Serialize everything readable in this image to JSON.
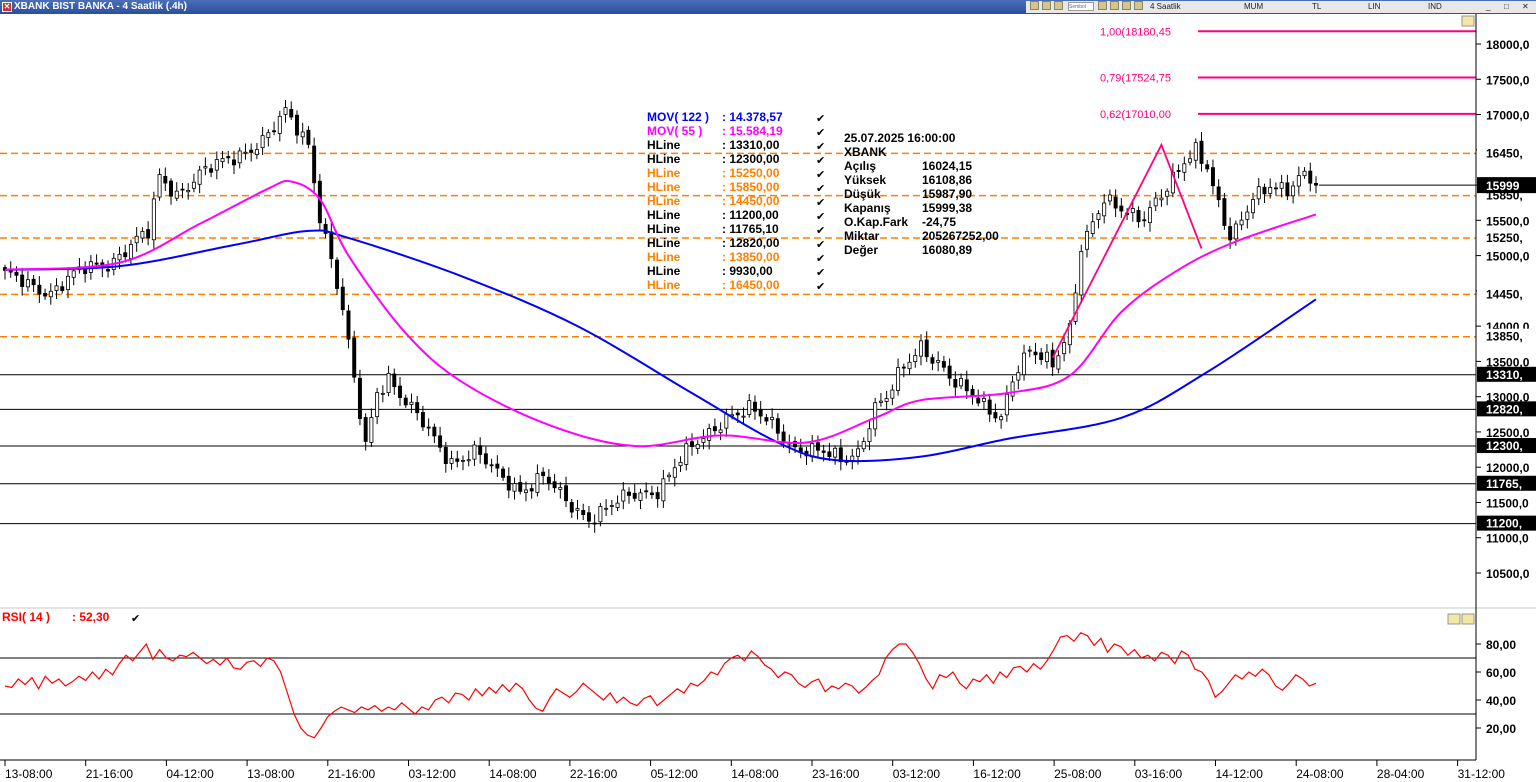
{
  "window": {
    "title": "XBANK BIST BANKA - 4 Saatlik (.4h)",
    "toolbar": {
      "period": "4 Saatlik",
      "chart_type": "MUM",
      "currency": "TL",
      "scale": "LIN",
      "indicator": "IND",
      "search_placeholder": "Sembol"
    }
  },
  "colors": {
    "mov122": "#0000ff",
    "mov55": "#ff00ff",
    "hline_black": "#000000",
    "hline_orange": "#ff8000",
    "fib": "#ff0080",
    "rsi": "#ff0000"
  },
  "legend": [
    {
      "name": "MOV( 122 )",
      "value": ": 14.378,57",
      "color": "#0000ff"
    },
    {
      "name": "MOV( 55 )",
      "value": ": 15.584,19",
      "color": "#ff00ff"
    },
    {
      "name": "HLine",
      "value": ": 13310,00",
      "color": "#000000"
    },
    {
      "name": "HLine",
      "value": ": 12300,00",
      "color": "#000000"
    },
    {
      "name": "HLine",
      "value": ": 15250,00",
      "color": "#ff8000"
    },
    {
      "name": "HLine",
      "value": ": 15850,00",
      "color": "#ff8000"
    },
    {
      "name": "HLine",
      "value": ": 14450,00",
      "color": "#ff8000"
    },
    {
      "name": "HLine",
      "value": ": 11200,00",
      "color": "#000000"
    },
    {
      "name": "HLine",
      "value": ": 11765,10",
      "color": "#000000"
    },
    {
      "name": "HLine",
      "value": ": 12820,00",
      "color": "#000000"
    },
    {
      "name": "HLine",
      "value": ": 13850,00",
      "color": "#ff8000"
    },
    {
      "name": "HLine",
      "value": ": 9930,00",
      "color": "#000000"
    },
    {
      "name": "HLine",
      "value": ": 16450,00",
      "color": "#ff8000"
    }
  ],
  "info_box": {
    "datetime": "25.07.2025  16:00:00",
    "symbol": "XBANK",
    "rows": [
      {
        "label": "Açılış",
        "value": "16024,15"
      },
      {
        "label": "Yüksek",
        "value": "16108,86"
      },
      {
        "label": "Düşük",
        "value": "15987,90"
      },
      {
        "label": "Kapanış",
        "value": "15999,38"
      },
      {
        "label": "O.Kap.Fark",
        "value": "-24,75"
      },
      {
        "label": "Miktar",
        "value": "205267252,00"
      },
      {
        "label": "Değer",
        "value": "16080,89"
      }
    ]
  },
  "fib_labels": [
    {
      "text": "1,00(18180,45",
      "level": 18180.45
    },
    {
      "text": "0,79(17524,75",
      "level": 17524.75
    },
    {
      "text": "0,62(17010,00",
      "level": 17010.0
    }
  ],
  "rsi_legend": {
    "name": "RSI( 14 )",
    "value": ": 52,30"
  },
  "chart_data": [
    {
      "type": "candlestick",
      "symbol": "XBANK",
      "timeframe": "4h",
      "y_axis": {
        "ticks": [
          "18000,0",
          "17500,0",
          "17000,0",
          "16500,0",
          "16000,0",
          "15500,0",
          "15000,0",
          "14500,0",
          "14000,0",
          "13500,0",
          "13000,0",
          "12500,0",
          "12000,0",
          "11500,0",
          "11000,0",
          "10500,0"
        ],
        "ylim": [
          10000,
          18400
        ],
        "last_price_label": "15999"
      },
      "x_ticks": [
        "13-08:00",
        "21-16:00",
        "04-12:00",
        "13-08:00",
        "21-16:00",
        "03-12:00",
        "14-08:00",
        "22-16:00",
        "05-12:00",
        "14-08:00",
        "23-16:00",
        "03-12:00",
        "16-12:00",
        "25-08:00",
        "03-16:00",
        "14-12:00",
        "24-08:00",
        "28-04:00",
        "31-12:00"
      ],
      "price_path": [
        [
          0,
          14700
        ],
        [
          8,
          14500
        ],
        [
          14,
          14800
        ],
        [
          18,
          14900
        ],
        [
          22,
          15150
        ],
        [
          25,
          15300
        ],
        [
          27,
          16100
        ],
        [
          30,
          15900
        ],
        [
          34,
          16150
        ],
        [
          38,
          16300
        ],
        [
          42,
          16500
        ],
        [
          46,
          16700
        ],
        [
          49,
          17000
        ],
        [
          53,
          16600
        ],
        [
          55,
          15600
        ],
        [
          57,
          14950
        ],
        [
          59,
          14200
        ],
        [
          61,
          13200
        ],
        [
          63,
          12300
        ],
        [
          65,
          13100
        ],
        [
          67,
          13300
        ],
        [
          70,
          12900
        ],
        [
          74,
          12500
        ],
        [
          78,
          12100
        ],
        [
          82,
          12200
        ],
        [
          86,
          11900
        ],
        [
          90,
          11700
        ],
        [
          94,
          11850
        ],
        [
          98,
          11500
        ],
        [
          102,
          11300
        ],
        [
          106,
          11450
        ],
        [
          110,
          11600
        ],
        [
          114,
          11700
        ],
        [
          118,
          12100
        ],
        [
          122,
          12400
        ],
        [
          126,
          12750
        ],
        [
          130,
          12800
        ],
        [
          134,
          12600
        ],
        [
          138,
          12300
        ],
        [
          142,
          12200
        ],
        [
          146,
          12100
        ],
        [
          149,
          12250
        ],
        [
          152,
          12850
        ],
        [
          154,
          12950
        ],
        [
          157,
          13400
        ],
        [
          160,
          13750
        ],
        [
          163,
          13500
        ],
        [
          166,
          13150
        ],
        [
          170,
          12950
        ],
        [
          174,
          12750
        ],
        [
          176,
          13250
        ],
        [
          179,
          13600
        ],
        [
          183,
          13500
        ],
        [
          186,
          14000
        ],
        [
          188,
          15100
        ],
        [
          190,
          15400
        ],
        [
          192,
          15750
        ],
        [
          195,
          15700
        ],
        [
          199,
          15550
        ],
        [
          203,
          15900
        ],
        [
          206,
          16350
        ],
        [
          208,
          16550
        ],
        [
          210,
          16300
        ],
        [
          212,
          15700
        ],
        [
          214,
          15200
        ],
        [
          216,
          15450
        ],
        [
          218,
          15850
        ],
        [
          221,
          16050
        ],
        [
          224,
          15900
        ],
        [
          227,
          16100
        ],
        [
          229,
          15999
        ]
      ],
      "total_slots": 270,
      "series": [
        {
          "name": "MOV( 122 )",
          "color": "#0000ff",
          "points": [
            [
              0,
              14800
            ],
            [
              20,
              14850
            ],
            [
              40,
              15150
            ],
            [
              53,
              15350
            ],
            [
              60,
              15250
            ],
            [
              80,
              14700
            ],
            [
              100,
              14000
            ],
            [
              120,
              13050
            ],
            [
              135,
              12350
            ],
            [
              145,
              12100
            ],
            [
              160,
              12150
            ],
            [
              175,
              12400
            ],
            [
              195,
              12700
            ],
            [
              210,
              13350
            ],
            [
              229,
              14380
            ]
          ]
        },
        {
          "name": "MOV( 55 )",
          "color": "#ff00ff",
          "points": [
            [
              0,
              14800
            ],
            [
              20,
              14900
            ],
            [
              34,
              15450
            ],
            [
              46,
              15950
            ],
            [
              50,
              16050
            ],
            [
              55,
              15800
            ],
            [
              60,
              15000
            ],
            [
              70,
              13900
            ],
            [
              80,
              13200
            ],
            [
              95,
              12600
            ],
            [
              110,
              12300
            ],
            [
              125,
              12450
            ],
            [
              140,
              12350
            ],
            [
              152,
              12700
            ],
            [
              160,
              12950
            ],
            [
              175,
              13050
            ],
            [
              186,
              13300
            ],
            [
              195,
              14200
            ],
            [
              205,
              14800
            ],
            [
              215,
              15200
            ],
            [
              229,
              15584
            ]
          ]
        }
      ],
      "horizontal_lines": {
        "orange": [
          16450,
          15850,
          15250,
          14450,
          13850
        ],
        "black": [
          13310,
          12820,
          12300,
          11765.1,
          11200
        ]
      },
      "right_labels": [
        "16450,",
        "15850,",
        "15250,",
        "14450,",
        "13850,",
        "13310,",
        "12820,",
        "12300,",
        "11765,",
        "11200,"
      ],
      "fib_trend_line": [
        [
          183,
          13550
        ],
        [
          202,
          16570
        ],
        [
          209,
          15100
        ]
      ]
    },
    {
      "type": "line",
      "name": "RSI( 14 )",
      "ylim": [
        0,
        100
      ],
      "y_ticks": [
        "80,00",
        "60,00",
        "40,00",
        "20,00"
      ],
      "levels": [
        70,
        30
      ],
      "values": [
        50,
        49,
        55,
        51,
        56,
        48,
        57,
        52,
        55,
        50,
        53,
        57,
        54,
        60,
        55,
        62,
        58,
        66,
        72,
        68,
        74,
        80,
        69,
        76,
        70,
        68,
        72,
        71,
        74,
        70,
        66,
        69,
        65,
        70,
        63,
        62,
        67,
        68,
        64,
        70,
        68,
        60,
        45,
        30,
        20,
        15,
        13,
        20,
        28,
        32,
        35,
        33,
        31,
        35,
        33,
        36,
        32,
        35,
        33,
        38,
        34,
        30,
        35,
        33,
        40,
        42,
        38,
        45,
        44,
        40,
        48,
        43,
        49,
        45,
        51,
        46,
        52,
        48,
        40,
        34,
        32,
        41,
        48,
        45,
        42,
        46,
        52,
        48,
        44,
        40,
        45,
        38,
        42,
        38,
        36,
        41,
        43,
        36,
        40,
        44,
        48,
        45,
        52,
        50,
        54,
        60,
        58,
        66,
        70,
        72,
        68,
        75,
        71,
        65,
        62,
        56,
        60,
        58,
        52,
        49,
        53,
        55,
        46,
        50,
        48,
        52,
        50,
        45,
        49,
        54,
        58,
        70,
        76,
        80,
        80,
        74,
        66,
        55,
        48,
        58,
        56,
        60,
        52,
        48,
        55,
        53,
        58,
        52,
        60,
        56,
        63,
        64,
        60,
        66,
        62,
        68,
        76,
        85,
        86,
        82,
        88,
        86,
        79,
        84,
        74,
        80,
        78,
        72,
        76,
        70,
        72,
        68,
        74,
        72,
        66,
        75,
        72,
        62,
        60,
        54,
        42,
        46,
        52,
        58,
        55,
        60,
        57,
        62,
        58,
        50,
        47,
        52,
        58,
        55,
        50,
        52
      ]
    }
  ]
}
